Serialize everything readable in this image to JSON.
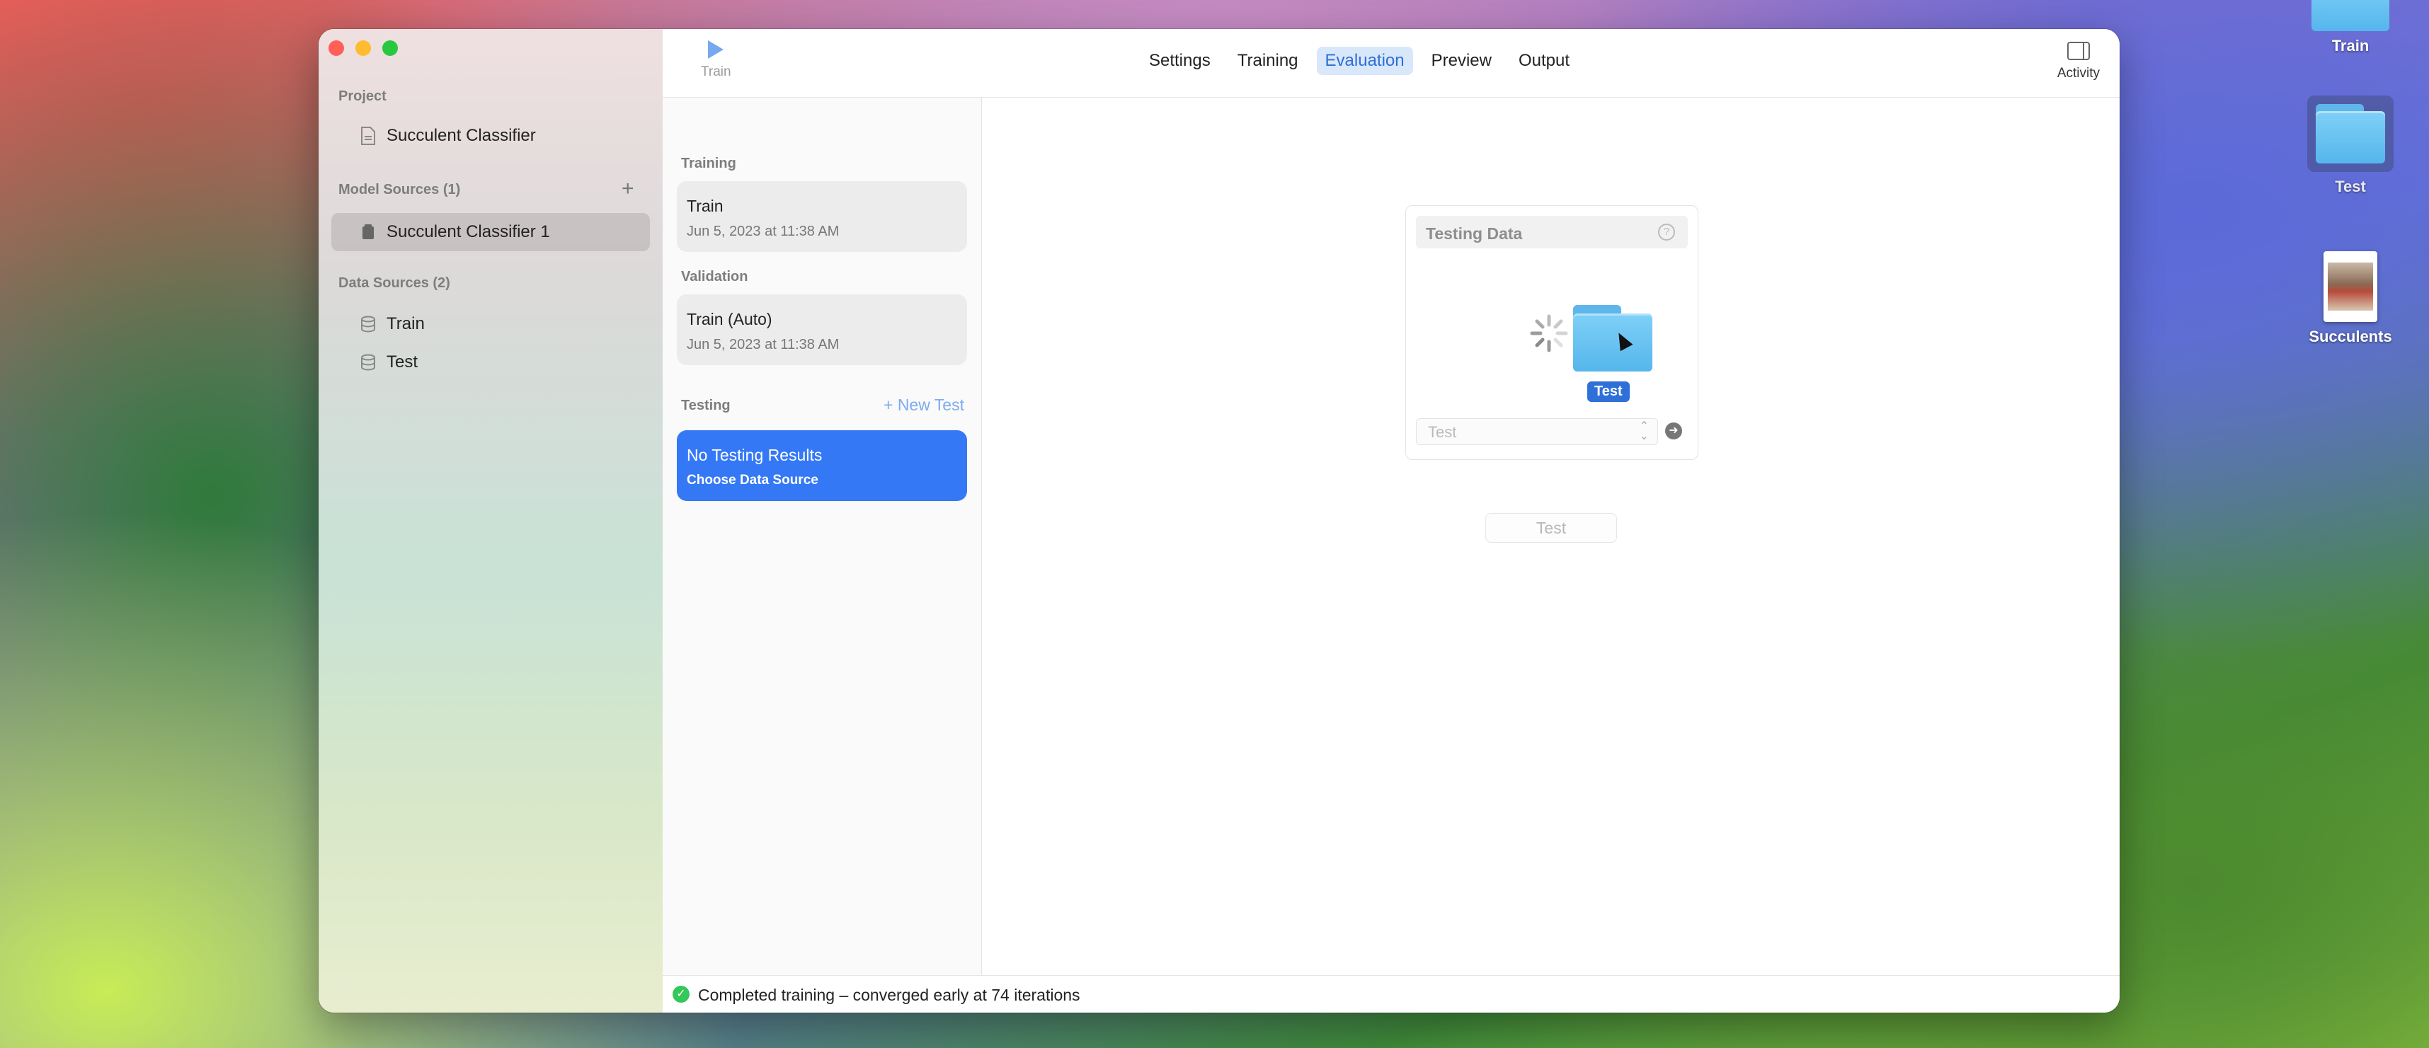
{
  "desktop": {
    "icons": [
      {
        "label": "Train"
      },
      {
        "label": "Test"
      },
      {
        "label": "Succulents"
      }
    ]
  },
  "sidebar": {
    "project_header": "Project",
    "project_item": "Succulent Classifier",
    "model_sources_header": "Model Sources (1)",
    "model_item": "Succulent Classifier 1",
    "data_sources_header": "Data Sources (2)",
    "data_items": [
      "Train",
      "Test"
    ]
  },
  "toolbar": {
    "train_label": "Train",
    "tabs": [
      "Settings",
      "Training",
      "Evaluation",
      "Preview",
      "Output"
    ],
    "active_tab": "Evaluation",
    "activity_label": "Activity"
  },
  "middle": {
    "training_header": "Training",
    "training_card": {
      "title": "Train",
      "date": "Jun 5, 2023 at 11:38 AM"
    },
    "validation_header": "Validation",
    "validation_card": {
      "title": "Train (Auto)",
      "date": "Jun 5, 2023 at 11:38 AM"
    },
    "testing_header": "Testing",
    "new_test_label": "+ New Test",
    "testing_card": {
      "title": "No Testing Results",
      "subtitle": "Choose Data Source"
    }
  },
  "evaluation": {
    "panel_title": "Testing Data",
    "drag_label": "Test",
    "select_value": "Test",
    "test_button": "Test"
  },
  "status": {
    "text": "Completed training – converged early at 74 iterations"
  },
  "colors": {
    "accent": "#3478f6",
    "success": "#34c759"
  }
}
